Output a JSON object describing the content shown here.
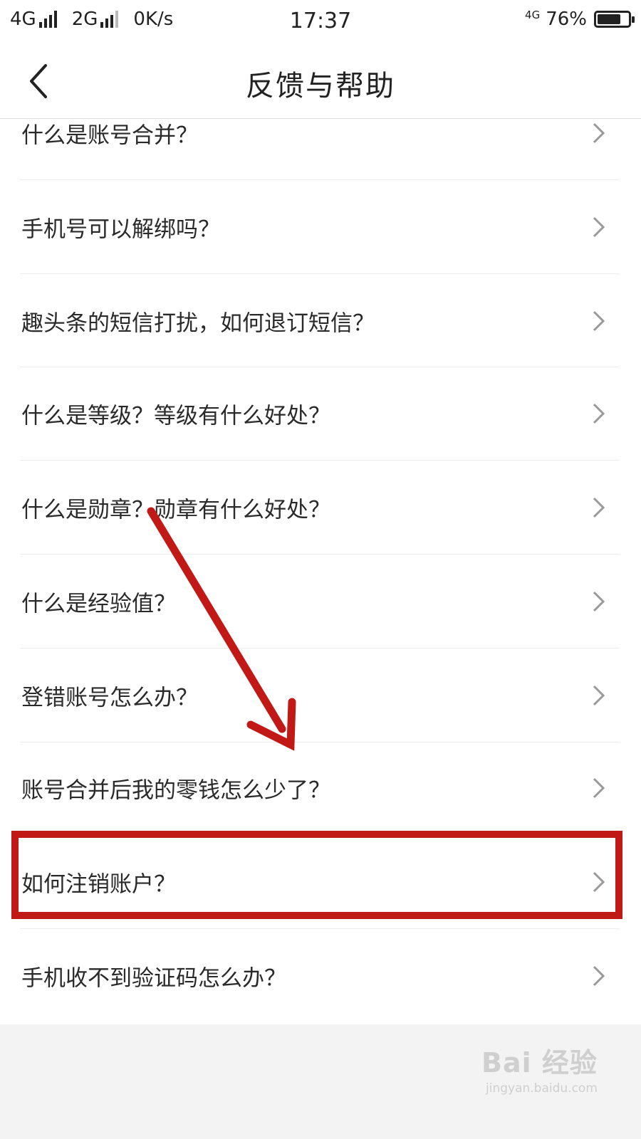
{
  "status_bar": {
    "network1": "4G",
    "network2": "2G",
    "speed": "0K/s",
    "time": "17:37",
    "network3": "4G",
    "battery_percent": "76%",
    "battery_level": 0.76
  },
  "header": {
    "title": "反馈与帮助",
    "back_icon": "chevron-left-icon"
  },
  "faq_items": [
    {
      "label": "什么是账号合并？"
    },
    {
      "label": "手机号可以解绑吗？"
    },
    {
      "label": "趣头条的短信打扰，如何退订短信？"
    },
    {
      "label": "什么是等级？等级有什么好处？"
    },
    {
      "label": "什么是勋章？勋章有什么好处？"
    },
    {
      "label": "什么是经验值？"
    },
    {
      "label": "登错账号怎么办？"
    },
    {
      "label": "账号合并后我的零钱怎么少了？"
    },
    {
      "label": "如何注销账户？"
    },
    {
      "label": "手机收不到验证码怎么办？"
    }
  ],
  "annotation": {
    "highlight_color": "#c11a16",
    "highlighted_item": "如何注销账户？"
  },
  "watermark": {
    "main": "Bai 经验",
    "sub": "jingyan.baidu.com"
  }
}
